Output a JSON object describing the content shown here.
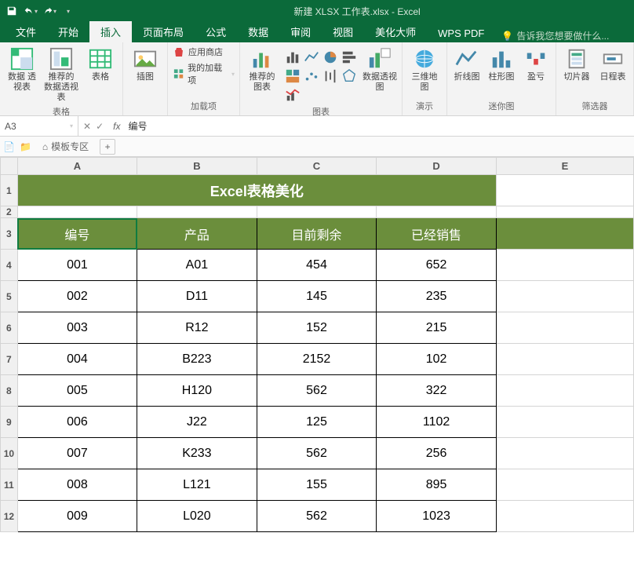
{
  "titlebar": {
    "title": "新建 XLSX 工作表.xlsx - Excel"
  },
  "tabs": {
    "file": "文件",
    "home": "开始",
    "insert": "插入",
    "layout": "页面布局",
    "formulas": "公式",
    "data": "数据",
    "review": "审阅",
    "view": "视图",
    "beautify": "美化大师",
    "wpspdf": "WPS PDF",
    "tell": "告诉我您想要做什么..."
  },
  "ribbon": {
    "groups": {
      "tables": {
        "label": "表格",
        "pivot": "数据\n透视表",
        "recommended_pivot": "推荐的\n数据透视表",
        "table": "表格"
      },
      "illustrations": {
        "label": "",
        "pictures": "插图"
      },
      "addins": {
        "label": "加载项",
        "store": "应用商店",
        "myaddins": "我的加载项"
      },
      "charts": {
        "label": "图表",
        "recommended": "推荐的\n图表",
        "pivotchart": "数据透视图"
      },
      "tours": {
        "label": "演示",
        "map3d": "三维地\n图"
      },
      "sparklines": {
        "label": "迷你图",
        "line": "折线图",
        "column": "柱形图",
        "winloss": "盈亏"
      },
      "filters": {
        "label": "筛选器",
        "slicer": "切片器",
        "timeline": "日程表"
      }
    }
  },
  "formulabar": {
    "namebox": "A3",
    "content": "编号",
    "fx": "fx"
  },
  "sheettabs": {
    "templates": "模板专区"
  },
  "grid": {
    "columns": [
      "A",
      "B",
      "C",
      "D",
      "E"
    ],
    "title": "Excel表格美化",
    "headers": [
      "编号",
      "产品",
      "目前剩余",
      "已经销售"
    ],
    "rows": [
      [
        "001",
        "A01",
        "454",
        "652"
      ],
      [
        "002",
        "D11",
        "145",
        "235"
      ],
      [
        "003",
        "R12",
        "152",
        "215"
      ],
      [
        "004",
        "B223",
        "2152",
        "102"
      ],
      [
        "005",
        "H120",
        "562",
        "322"
      ],
      [
        "006",
        "J22",
        "125",
        "1102"
      ],
      [
        "007",
        "K233",
        "562",
        "256"
      ],
      [
        "008",
        "L121",
        "155",
        "895"
      ],
      [
        "009",
        "L020",
        "562",
        "1023"
      ]
    ],
    "selected_cell": "A3"
  }
}
